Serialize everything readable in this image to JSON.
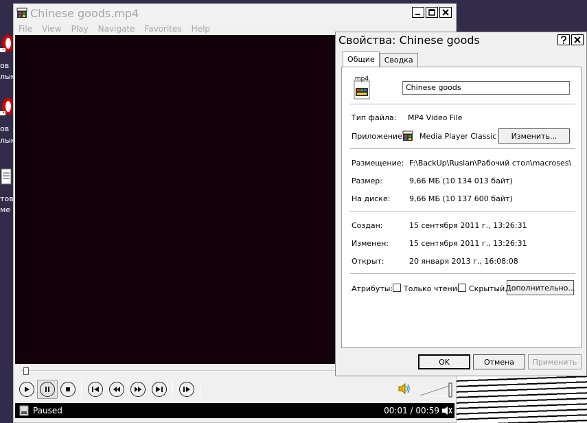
{
  "desktop": {
    "icons": [
      {
        "label1": "ов",
        "label2": "лык"
      },
      {
        "label1": "ов",
        "label2": "лык"
      },
      {
        "label1": "тов",
        "label2": "ме"
      }
    ]
  },
  "player": {
    "title": "Chinese goods.mp4",
    "menu": [
      "File",
      "View",
      "Play",
      "Navigate",
      "Favorites",
      "Help"
    ],
    "status": "Paused",
    "time": "00:01 / 00:59",
    "colors": {
      "video_bg": "#13000b",
      "status_bg": "#000000"
    }
  },
  "dialog": {
    "title": "Свойства: Chinese goods",
    "tabs": [
      "Общие",
      "Сводка"
    ],
    "file_icon_label": ".mp4",
    "name_value": "Chinese goods",
    "file_type_label": "Тип файла:",
    "file_type_value": "MP4 Video File",
    "app_label": "Приложение:",
    "app_value": "Media Player Classic -",
    "change_button": "Изменить...",
    "location_label": "Размещение:",
    "location_value": "F:\\BackUp\\Ruslan\\Рабочий стол\\macroses\\LYT",
    "size_label": "Размер:",
    "size_value": "9,66 МБ (10 134 013 байт)",
    "disk_label": "На диске:",
    "disk_value": "9,66 МБ (10 137 600 байт)",
    "created_label": "Создан:",
    "created_value": "15 сентября 2011 г., 13:26:31",
    "modified_label": "Изменен:",
    "modified_value": "15 сентября 2011 г., 13:26:31",
    "opened_label": "Открыт:",
    "opened_value": "20 января 2013 г., 16:08:08",
    "attrs_label": "Атрибуты:",
    "readonly_label": "Только чтение",
    "hidden_label": "Скрытый",
    "advanced_button": "Дополнительно...",
    "ok_button": "OK",
    "cancel_button": "Отмена",
    "apply_button": "Применить"
  }
}
